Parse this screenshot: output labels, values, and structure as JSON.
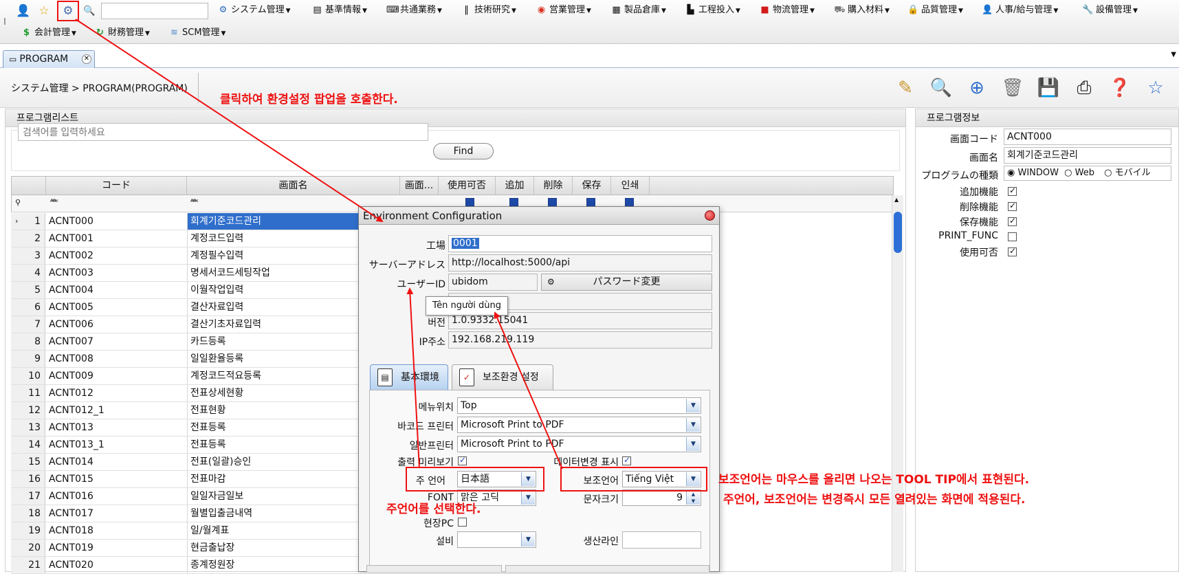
{
  "menu": {
    "row1": [
      {
        "label": "システム管理",
        "icon": "gear-icon"
      },
      {
        "label": "基準情報",
        "icon": "id-card-icon"
      },
      {
        "label": "共通業務",
        "icon": "keyboard-icon"
      },
      {
        "label": "技術研究",
        "icon": "barcode-icon"
      },
      {
        "label": "営業管理",
        "icon": "chrome-icon"
      },
      {
        "label": "製品倉庫",
        "icon": "building-icon"
      },
      {
        "label": "工程投入",
        "icon": "factory-icon"
      },
      {
        "label": "物流管理",
        "icon": "bus-icon"
      },
      {
        "label": "購入材料",
        "icon": "cart-icon"
      },
      {
        "label": "品質管理",
        "icon": "lock-icon"
      },
      {
        "label": "人事/給与管理",
        "icon": "user-icon"
      },
      {
        "label": "設備管理",
        "icon": "wrench-icon"
      }
    ],
    "row2": [
      {
        "label": "会計管理",
        "icon": "dollar-icon"
      },
      {
        "label": "財務管理",
        "icon": "refresh-icon"
      },
      {
        "label": "SCM管理",
        "icon": "waves-icon"
      }
    ]
  },
  "tabs": {
    "program": "PROGRAM"
  },
  "breadcrumb": "システム管理 > PROGRAM(PROGRAM)",
  "left_panel": {
    "title": "프로그램리스트",
    "search_placeholder": "검색어를 입력하세요",
    "find_label": "Find",
    "columns": [
      "コード",
      "画面名",
      "画面...",
      "使用可否",
      "追加",
      "削除",
      "保存",
      "인쇄"
    ],
    "rows": [
      {
        "no": "1",
        "code": "ACNT000",
        "name": "회계기준코드관리"
      },
      {
        "no": "2",
        "code": "ACNT001",
        "name": "계정코드입력"
      },
      {
        "no": "3",
        "code": "ACNT002",
        "name": "계정필수입력"
      },
      {
        "no": "4",
        "code": "ACNT003",
        "name": "명세서코드세팅작업"
      },
      {
        "no": "5",
        "code": "ACNT004",
        "name": "이월작업입력"
      },
      {
        "no": "6",
        "code": "ACNT005",
        "name": "결산자료입력"
      },
      {
        "no": "7",
        "code": "ACNT006",
        "name": "결산기초자료입력"
      },
      {
        "no": "8",
        "code": "ACNT007",
        "name": "카드등록"
      },
      {
        "no": "9",
        "code": "ACNT008",
        "name": "일일환율등록"
      },
      {
        "no": "10",
        "code": "ACNT009",
        "name": "계정코드적요등록"
      },
      {
        "no": "11",
        "code": "ACNT012",
        "name": "전표상세현황"
      },
      {
        "no": "12",
        "code": "ACNT012_1",
        "name": "전표현황"
      },
      {
        "no": "13",
        "code": "ACNT013",
        "name": "전표등록"
      },
      {
        "no": "14",
        "code": "ACNT013_1",
        "name": "전표등록"
      },
      {
        "no": "15",
        "code": "ACNT014",
        "name": "전표(일괄)승인"
      },
      {
        "no": "16",
        "code": "ACNT015",
        "name": "전표마감"
      },
      {
        "no": "17",
        "code": "ACNT016",
        "name": "일일자금일보"
      },
      {
        "no": "18",
        "code": "ACNT017",
        "name": "월별입출금내역"
      },
      {
        "no": "19",
        "code": "ACNT018",
        "name": "일/월계표"
      },
      {
        "no": "20",
        "code": "ACNT019",
        "name": "현금출납장"
      },
      {
        "no": "21",
        "code": "ACNT020",
        "name": "종계정원장"
      }
    ]
  },
  "right_panel": {
    "title": "프로그램정보",
    "screen_code_label": "画面コード",
    "screen_code": "ACNT000",
    "screen_name_label": "画面名",
    "screen_name": "회계기준코드관리",
    "program_type_label": "プログラムの種類",
    "program_types": [
      "WINDOW",
      "Web",
      "モバイル"
    ],
    "add_label": "追加機能",
    "delete_label": "削除機能",
    "save_label": "保存機能",
    "print_label": "PRINT_FUNC",
    "use_label": "使用可否"
  },
  "dialog": {
    "title": "Environment Configuration",
    "factory_label": "工場",
    "factory": "0001",
    "server_label": "サーバーアドレス",
    "server": "http://localhost:5000/api",
    "user_label": "ユーザーID",
    "user": "ubidom",
    "password_change": "パスワード変更",
    "tooltip": "Tên người dùng",
    "version_label": "버전",
    "version": "1.0.9332.15041",
    "ip_label": "IP주소",
    "ip": "192.168.219.119",
    "tab_basic": "基本環境",
    "tab_sub": "보조환경 설정",
    "menu_pos_label": "메뉴위치",
    "menu_pos": "Top",
    "barcode_printer_label": "바코드 프린터",
    "barcode_printer": "Microsoft Print to PDF",
    "general_printer_label": "일반프린터",
    "general_printer": "Microsoft Print to PDF",
    "print_preview_label": "출력 미리보기",
    "data_change_label": "데이터변경 표시",
    "main_lang_label": "주 언어",
    "main_lang": "日本語",
    "sub_lang_label": "보조언어",
    "sub_lang": "Tiếng Việt",
    "font_label": "FONT",
    "font": "맑은 고딕",
    "font_size_label": "문자크기",
    "font_size": "9",
    "field_pc_label": "현장PC",
    "equipment_label": "설비",
    "line_label": "생산라인"
  },
  "annotations": {
    "click_settings": "클릭하여 환경설정 팝업을 호출한다.",
    "main_lang_note": "주언어를 선택한다.",
    "sub_lang_note1": "보조언어는 마우스를 올리면 나오는 TOOL TIP에서 표현된다.",
    "sub_lang_note2": "주언어, 보조언어는 변경즉시 모든 열려있는 화면에 적용된다."
  },
  "colors": {
    "annotation": "#ee1111",
    "selection": "#2f6ecb"
  }
}
